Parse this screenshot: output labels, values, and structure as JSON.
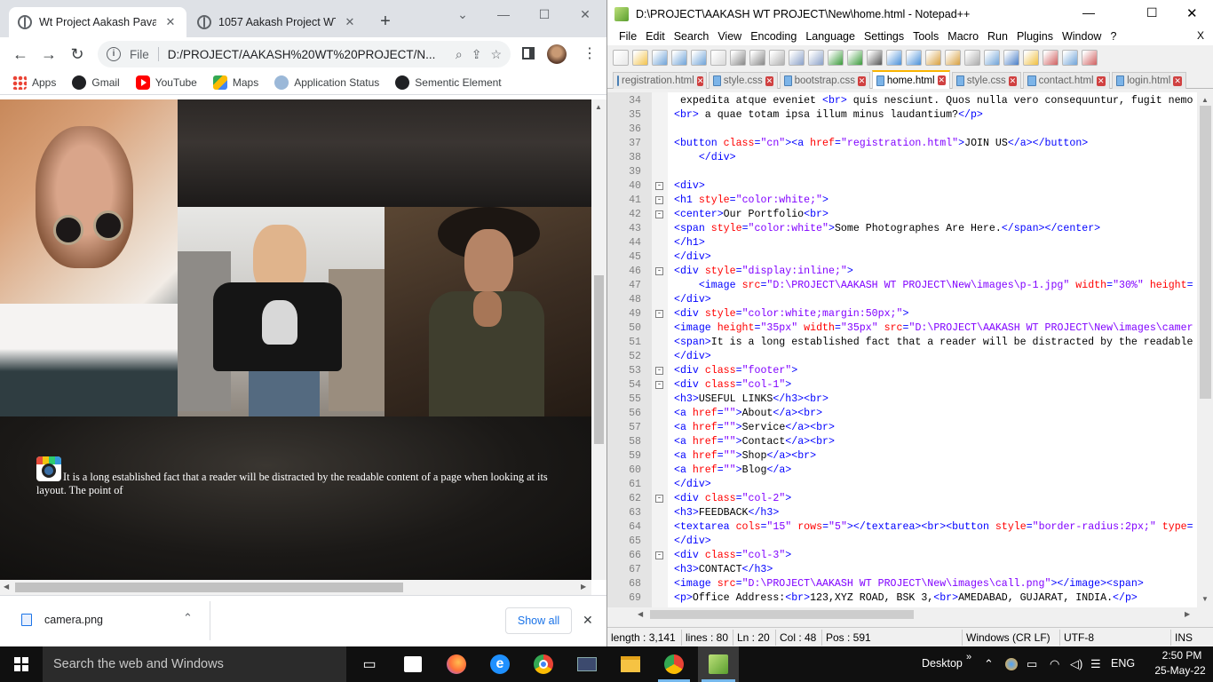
{
  "chrome": {
    "tabs": [
      {
        "title": "Wt Project Aakash Pavar",
        "close": "✕"
      },
      {
        "title": "1057 Aakash Project WT",
        "close": "✕"
      }
    ],
    "new_tab": "+",
    "omnibox": {
      "scheme_label": "File",
      "url": "D:/PROJECT/AAKASH%20WT%20PROJECT/N..."
    },
    "bookmarks": [
      {
        "label": "Apps",
        "icon": "apps-grid-icon"
      },
      {
        "label": "Gmail",
        "icon": "globe-icon"
      },
      {
        "label": "YouTube",
        "icon": "youtube-icon"
      },
      {
        "label": "Maps",
        "icon": "maps-icon"
      },
      {
        "label": "Application Status",
        "icon": "status-icon"
      },
      {
        "label": "Sementic Element",
        "icon": "globe-icon"
      }
    ],
    "page": {
      "paragraph": "It is a long established fact that a reader will be distracted by the readable content of a page when looking at its layout. The point of"
    },
    "downloads": {
      "file": "camera.png",
      "show_all": "Show all",
      "close": "✕"
    }
  },
  "npp": {
    "title": "D:\\PROJECT\\AAKASH WT PROJECT\\New\\home.html - Notepad++",
    "menu": [
      "File",
      "Edit",
      "Search",
      "View",
      "Encoding",
      "Language",
      "Settings",
      "Tools",
      "Macro",
      "Run",
      "Plugins",
      "Window",
      "?"
    ],
    "close_doc": "X",
    "tabs": [
      {
        "label": "registration.html",
        "active": false
      },
      {
        "label": "style.css",
        "active": false
      },
      {
        "label": "bootstrap.css",
        "active": false
      },
      {
        "label": "home.html",
        "active": true
      },
      {
        "label": "style.css",
        "active": false
      },
      {
        "label": "contact.html",
        "active": false
      },
      {
        "label": "login.html",
        "active": false
      }
    ],
    "lines": [
      {
        "n": "34",
        "fold": "",
        "html": " expedita atque eveniet <span class='kw'>&lt;br&gt;</span> quis nesciunt. Quos nulla vero consequuntur, fugit nemo"
      },
      {
        "n": "35",
        "fold": "",
        "html": "<span class='kw'>&lt;br&gt;</span> a quae totam ipsa illum minus laudantium?<span class='kw'>&lt;/p&gt;</span>"
      },
      {
        "n": "36",
        "fold": "",
        "html": ""
      },
      {
        "n": "37",
        "fold": "",
        "html": "<span class='kw'>&lt;button</span> <span class='at'>class</span><span class='kw'>=</span><span class='st'>\"cn\"</span><span class='kw'>&gt;&lt;a</span> <span class='at'>href</span><span class='kw'>=</span><span class='st'>\"registration.html\"</span><span class='kw'>&gt;</span>JOIN US<span class='kw'>&lt;/a&gt;&lt;/button&gt;</span>"
      },
      {
        "n": "38",
        "fold": "",
        "html": "    <span class='kw'>&lt;/div&gt;</span>"
      },
      {
        "n": "39",
        "fold": "",
        "html": ""
      },
      {
        "n": "40",
        "fold": "-",
        "html": "<span class='kw'>&lt;div&gt;</span>"
      },
      {
        "n": "41",
        "fold": "-",
        "html": "<span class='kw'>&lt;h1</span> <span class='at'>style</span><span class='kw'>=</span><span class='st'>\"color:white;\"</span><span class='kw'>&gt;</span>"
      },
      {
        "n": "42",
        "fold": "-",
        "html": "<span class='kw'>&lt;center&gt;</span>Our Portfolio<span class='kw'>&lt;br&gt;</span>"
      },
      {
        "n": "43",
        "fold": "",
        "html": "<span class='kw'>&lt;span</span> <span class='at'>style</span><span class='kw'>=</span><span class='st'>\"color:white\"</span><span class='kw'>&gt;</span>Some Photographes Are Here.<span class='kw'>&lt;/span&gt;&lt;/center&gt;</span>"
      },
      {
        "n": "44",
        "fold": "",
        "html": "<span class='kw'>&lt;/h1&gt;</span>"
      },
      {
        "n": "45",
        "fold": "",
        "html": "<span class='kw'>&lt;/div&gt;</span>"
      },
      {
        "n": "46",
        "fold": "-",
        "html": "<span class='kw'>&lt;div</span> <span class='at'>style</span><span class='kw'>=</span><span class='st'>\"display:inline;\"</span><span class='kw'>&gt;</span>"
      },
      {
        "n": "47",
        "fold": "",
        "html": "    <span class='kw'>&lt;image</span> <span class='at'>src</span><span class='kw'>=</span><span class='st'>\"D:\\PROJECT\\AAKASH WT PROJECT\\New\\images\\p-1.jpg\"</span> <span class='at'>width</span><span class='kw'>=</span><span class='st'>\"30%\"</span> <span class='at'>height</span><span class='kw'>=</span>"
      },
      {
        "n": "48",
        "fold": "",
        "html": "<span class='kw'>&lt;/div&gt;</span>"
      },
      {
        "n": "49",
        "fold": "-",
        "html": "<span class='kw'>&lt;div</span> <span class='at'>style</span><span class='kw'>=</span><span class='st'>\"color:white;margin:50px;\"</span><span class='kw'>&gt;</span>"
      },
      {
        "n": "50",
        "fold": "",
        "html": "<span class='kw'>&lt;image</span> <span class='at'>height</span><span class='kw'>=</span><span class='st'>\"35px\"</span> <span class='at'>width</span><span class='kw'>=</span><span class='st'>\"35px\"</span> <span class='at'>src</span><span class='kw'>=</span><span class='st'>\"D:\\PROJECT\\AAKASH WT PROJECT\\New\\images\\camer</span>"
      },
      {
        "n": "51",
        "fold": "",
        "html": "<span class='kw'>&lt;span&gt;</span>It is a long established fact that a reader will be distracted by the readable"
      },
      {
        "n": "52",
        "fold": "",
        "html": "<span class='kw'>&lt;/div&gt;</span>"
      },
      {
        "n": "53",
        "fold": "-",
        "html": "<span class='kw'>&lt;div</span> <span class='at'>class</span><span class='kw'>=</span><span class='st'>\"footer\"</span><span class='kw'>&gt;</span>"
      },
      {
        "n": "54",
        "fold": "-",
        "html": "<span class='kw'>&lt;div</span> <span class='at'>class</span><span class='kw'>=</span><span class='st'>\"col-1\"</span><span class='kw'>&gt;</span>"
      },
      {
        "n": "55",
        "fold": "",
        "html": "<span class='kw'>&lt;h3&gt;</span>USEFUL LINKS<span class='kw'>&lt;/h3&gt;&lt;br&gt;</span>"
      },
      {
        "n": "56",
        "fold": "",
        "html": "<span class='kw'>&lt;a</span> <span class='at'>href</span><span class='kw'>=</span><span class='st'>\"\"</span><span class='kw'>&gt;</span>About<span class='kw'>&lt;/a&gt;&lt;br&gt;</span>"
      },
      {
        "n": "57",
        "fold": "",
        "html": "<span class='kw'>&lt;a</span> <span class='at'>href</span><span class='kw'>=</span><span class='st'>\"\"</span><span class='kw'>&gt;</span>Service<span class='kw'>&lt;/a&gt;&lt;br&gt;</span>"
      },
      {
        "n": "58",
        "fold": "",
        "html": "<span class='kw'>&lt;a</span> <span class='at'>href</span><span class='kw'>=</span><span class='st'>\"\"</span><span class='kw'>&gt;</span>Contact<span class='kw'>&lt;/a&gt;&lt;br&gt;</span>"
      },
      {
        "n": "59",
        "fold": "",
        "html": "<span class='kw'>&lt;a</span> <span class='at'>href</span><span class='kw'>=</span><span class='st'>\"\"</span><span class='kw'>&gt;</span>Shop<span class='kw'>&lt;/a&gt;&lt;br&gt;</span>"
      },
      {
        "n": "60",
        "fold": "",
        "html": "<span class='kw'>&lt;a</span> <span class='at'>href</span><span class='kw'>=</span><span class='st'>\"\"</span><span class='kw'>&gt;</span>Blog<span class='kw'>&lt;/a&gt;</span>"
      },
      {
        "n": "61",
        "fold": "",
        "html": "<span class='kw'>&lt;/div&gt;</span>"
      },
      {
        "n": "62",
        "fold": "-",
        "html": "<span class='kw'>&lt;div</span> <span class='at'>class</span><span class='kw'>=</span><span class='st'>\"col-2\"</span><span class='kw'>&gt;</span>"
      },
      {
        "n": "63",
        "fold": "",
        "html": "<span class='kw'>&lt;h3&gt;</span>FEEDBACK<span class='kw'>&lt;/h3&gt;</span>"
      },
      {
        "n": "64",
        "fold": "",
        "html": "<span class='kw'>&lt;textarea</span> <span class='at'>cols</span><span class='kw'>=</span><span class='st'>\"15\"</span> <span class='at'>rows</span><span class='kw'>=</span><span class='st'>\"5\"</span><span class='kw'>&gt;&lt;/textarea&gt;&lt;br&gt;&lt;button</span> <span class='at'>style</span><span class='kw'>=</span><span class='st'>\"border-radius:2px;\"</span> <span class='at'>type</span><span class='kw'>=</span>"
      },
      {
        "n": "65",
        "fold": "",
        "html": "<span class='kw'>&lt;/div&gt;</span>"
      },
      {
        "n": "66",
        "fold": "-",
        "html": "<span class='kw'>&lt;div</span> <span class='at'>class</span><span class='kw'>=</span><span class='st'>\"col-3\"</span><span class='kw'>&gt;</span>"
      },
      {
        "n": "67",
        "fold": "",
        "html": "<span class='kw'>&lt;h3&gt;</span>CONTACT<span class='kw'>&lt;/h3&gt;</span>"
      },
      {
        "n": "68",
        "fold": "",
        "html": "<span class='kw'>&lt;image</span> <span class='at'>src</span><span class='kw'>=</span><span class='st'>\"D:\\PROJECT\\AAKASH WT PROJECT\\New\\images\\call.png\"</span><span class='kw'>&gt;&lt;/image&gt;&lt;span&gt;</span>"
      },
      {
        "n": "69",
        "fold": "",
        "html": "<span class='kw'>&lt;p&gt;</span>Office Address:<span class='kw'>&lt;br&gt;</span>123,XYZ ROAD, BSK 3,<span class='kw'>&lt;br&gt;</span>AMEDABAD, GUJARAT, INDIA.<span class='kw'>&lt;/p&gt;</span>"
      }
    ],
    "status": {
      "length": "length : 3,141",
      "lines": "lines : 80",
      "ln": "Ln : 20",
      "col": "Col : 48",
      "pos": "Pos : 591",
      "eol": "Windows (CR LF)",
      "encoding": "UTF-8",
      "mode": "INS"
    }
  },
  "taskbar": {
    "search_placeholder": "Search the web and Windows",
    "desktop_label": "Desktop",
    "language": "ENG",
    "time": "2:50 PM",
    "date": "25-May-22"
  }
}
